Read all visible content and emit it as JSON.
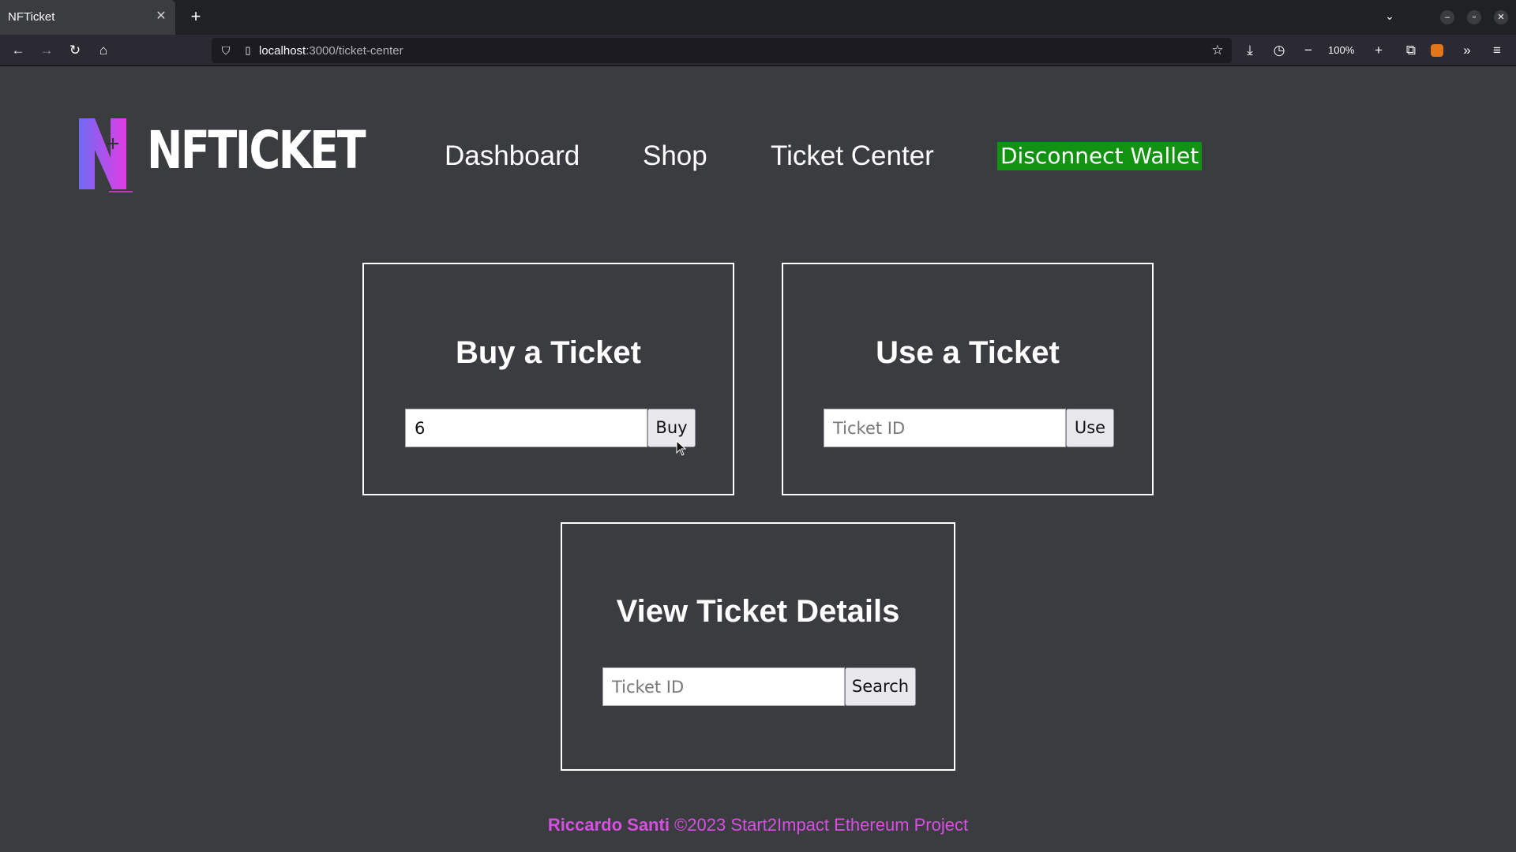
{
  "browser": {
    "tab_title": "NFTicket",
    "tab_close": "✕",
    "new_tab": "+",
    "tab_list": "⌄",
    "url_host": "localhost",
    "url_rest": ":3000/ticket-center",
    "zoom": "100%",
    "icons": [
      "back-icon",
      "forward-icon",
      "reload-icon",
      "home-icon",
      "shield-icon",
      "page-icon",
      "star-icon",
      "download-icon",
      "history-icon",
      "zoom-out-icon",
      "zoom-in-icon",
      "extensions-icon",
      "metamask-icon",
      "overflow-icon",
      "menu-icon"
    ]
  },
  "header": {
    "logo_text": "NFTICKET",
    "nav": {
      "dashboard": "Dashboard",
      "shop": "Shop",
      "ticket_center": "Ticket Center"
    },
    "wallet_button": "Disconnect Wallet",
    "wallet_color": "#119311"
  },
  "buy_card": {
    "title": "Buy a Ticket",
    "input_value": "6",
    "button": "Buy"
  },
  "use_card": {
    "title": "Use a Ticket",
    "input_placeholder": "Ticket ID",
    "button": "Use"
  },
  "view_card": {
    "title": "View Ticket Details",
    "input_placeholder": "Ticket ID",
    "button": "Search"
  },
  "footer": {
    "author": "Riccardo Santi",
    "text": " ©2023 Start2Impact Ethereum Project",
    "color": "#d64fe2"
  }
}
